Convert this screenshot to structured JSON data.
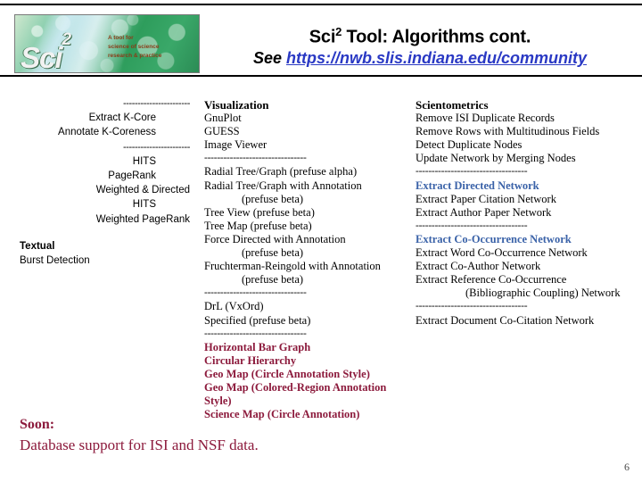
{
  "header": {
    "title_prefix": "Sci",
    "title_sup": "2",
    "title_rest": " Tool: Algorithms cont.",
    "see_label": "See ",
    "url": "https://nwb.slis.indiana.edu/community",
    "logo_word": "Sci",
    "logo_sup": "2",
    "logo_tagline_1": "A tool for",
    "logo_tagline_2": "science of science",
    "logo_tagline_3": "research & practice"
  },
  "left_column": {
    "divider_1": "-----------------------",
    "item_extract_k_core": "Extract K-Core",
    "item_annotate_k_coreness": "Annotate K-Coreness",
    "divider_2": "-----------------------",
    "item_hits_1": "HITS",
    "item_pagerank": "PageRank",
    "item_weighted_directed": "Weighted & Directed",
    "item_hits_2": "HITS",
    "item_weighted_pagerank": "Weighted PageRank",
    "heading_textual": "Textual",
    "item_burst_detection": "Burst Detection"
  },
  "visualization_column": {
    "heading": "Visualization",
    "item_gnuplot": "GnuPlot",
    "item_guess": "GUESS",
    "item_image_viewer": "Image Viewer",
    "divider_1": "--------------------------------",
    "item_radial_tree_alpha": "Radial Tree/Graph (prefuse alpha)",
    "item_radial_tree_annotation": "Radial Tree/Graph with Annotation",
    "item_radial_tree_annotation_sub": "(prefuse beta)",
    "item_tree_view": "Tree View (prefuse beta)",
    "item_tree_map": "Tree Map (prefuse beta)",
    "item_force_directed": "Force Directed with Annotation",
    "item_force_directed_sub": "(prefuse beta)",
    "item_fruchterman": "Fruchterman-Reingold with Annotation",
    "item_fruchterman_sub": "(prefuse beta)",
    "divider_2": "--------------------------------",
    "item_drl": "DrL  (VxOrd)",
    "item_specified": "Specified (prefuse beta)",
    "divider_3": "--------------------------------",
    "item_horizontal_bar_graph": "Horizontal Bar Graph",
    "item_circular_hierarchy": "Circular Hierarchy",
    "item_geo_map_circle": "Geo Map (Circle Annotation Style)",
    "item_geo_map_colored": "Geo Map (Colored-Region Annotation Style)",
    "item_science_map": "Science Map (Circle Annotation)"
  },
  "scientometrics_column": {
    "heading": "Scientometrics",
    "item_remove_isi": "Remove ISI Duplicate Records",
    "item_remove_rows": "Remove Rows with Multitudinous Fields",
    "item_detect_duplicate": "Detect Duplicate Nodes",
    "item_update_network": "Update Network by Merging Nodes",
    "divider_1": "-----------------------------------",
    "item_extract_directed": "Extract Directed Network",
    "item_extract_paper_citation": "Extract Paper Citation Network",
    "item_extract_author_paper": "Extract Author Paper Network",
    "divider_2": "-----------------------------------",
    "item_extract_cooccurrence": "Extract Co-Occurrence Network",
    "item_extract_word_cooccurrence": "Extract Word Co-Occurrence Network",
    "item_extract_coauthor": "Extract Co-Author Network",
    "item_extract_reference_cooccurrence": "Extract Reference Co-Occurrence",
    "item_extract_reference_cooccurrence_sub": "(Bibliographic Coupling) Network",
    "divider_3": "-----------------------------------",
    "item_extract_document_cocitation": "Extract Document Co-Citation Network"
  },
  "footer": {
    "soon_label": "Soon:",
    "soon_text": "Database support for ISI and NSF data.",
    "page_number": "6"
  },
  "colors": {
    "maroon": "#8c1a3c",
    "blue_link": "#2a39c4",
    "blue_heading": "#3a62a8"
  }
}
